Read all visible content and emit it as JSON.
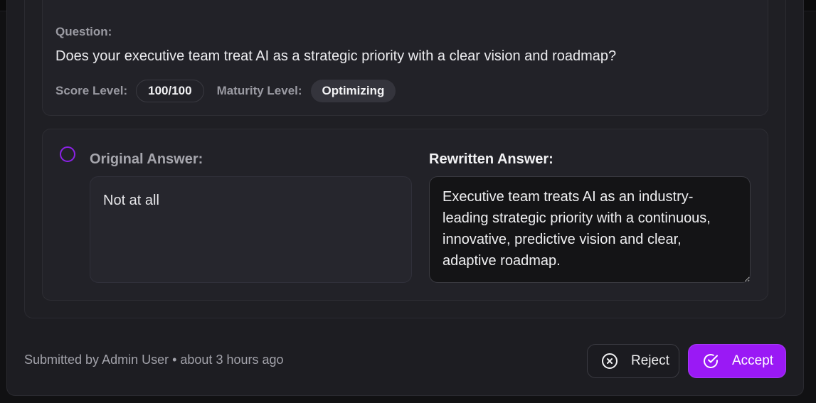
{
  "question": {
    "label": "Question:",
    "text": "Does your executive team treat AI as a strategic priority with a clear vision and roadmap?",
    "score_label": "Score Level:",
    "score_value": "100/100",
    "maturity_label": "Maturity Level:",
    "maturity_value": "Optimizing"
  },
  "answers": {
    "original_title": "Original Answer:",
    "original_text": "Not at all",
    "rewritten_title": "Rewritten Answer:",
    "rewritten_text": "Executive team treats AI as an industry-leading strategic priority with a continuous, innovative, predictive vision and clear, adaptive roadmap."
  },
  "footer": {
    "submitted": "Submitted by Admin User • about 3 hours ago",
    "reject_label": "Reject",
    "accept_label": "Accept"
  },
  "colors": {
    "accent": "#9a19f5",
    "radio_border": "#8b22e6",
    "background": "#111113"
  },
  "icons": {
    "reject": "x-circle-icon",
    "accept": "check-circle-icon"
  }
}
